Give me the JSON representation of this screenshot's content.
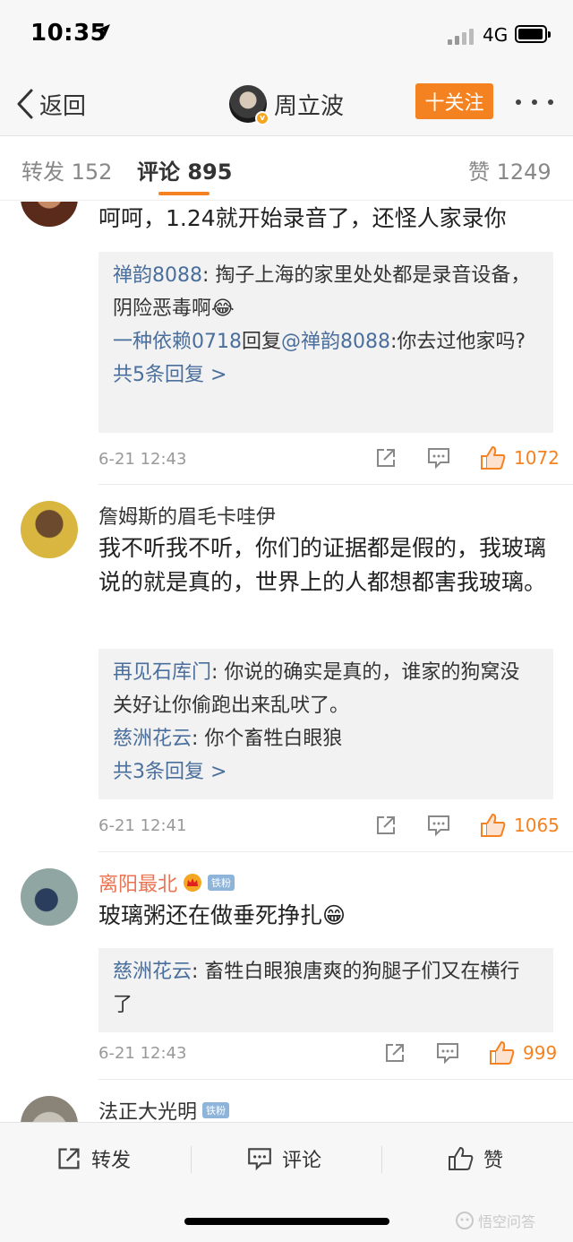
{
  "status_bar": {
    "time": "10:35",
    "network": "4G"
  },
  "nav": {
    "back_label": "返回",
    "profile_name": "周立波",
    "follow_label": "十关注"
  },
  "tabs": [
    {
      "label": "转发 152"
    },
    {
      "label": "评论 895",
      "active": true
    },
    {
      "label": "赞 1249"
    }
  ],
  "comments": [
    {
      "text": "呵呵，1.24就开始录音了，还怪人家录你",
      "replies": [
        {
          "user": "禅韵8088",
          "text": ": 掏子上海的家里处处都是录音设备，阴险恶毒啊😂"
        },
        {
          "user": "一种依赖0718",
          "mid": "回复",
          "user2": "@禅韵8088",
          "text": ":你去过他家吗?"
        }
      ],
      "more_replies": "共5条回复 >",
      "time": "6-21 12:43",
      "likes": "1072"
    },
    {
      "name": "詹姆斯的眉毛卡哇伊",
      "text": "我不听我不听，你们的证据都是假的，我玻璃说的就是真的，世界上的人都想都害我玻璃。",
      "replies": [
        {
          "user": "再见石库门",
          "text": ": 你说的确实是真的，谁家的狗窝没关好让你偷跑出来乱吠了。"
        },
        {
          "user": "慈洲花云",
          "text": ": 你个畜牲白眼狼"
        }
      ],
      "more_replies": "共3条回复 >",
      "time": "6-21 12:41",
      "likes": "1065"
    },
    {
      "name": "离阳最北",
      "badge": "铁粉",
      "text": "玻璃粥还在做垂死挣扎😁",
      "replies": [
        {
          "user": "慈洲花云",
          "text": ": 畜牲白眼狼唐爽的狗腿子们又在横行了"
        }
      ],
      "time": "6-21 12:43",
      "likes": "999"
    },
    {
      "name": "法正大光明",
      "badge": "铁粉"
    }
  ],
  "toolbar": {
    "repost_label": "转发",
    "comment_label": "评论",
    "like_label": "赞"
  },
  "watermark": "悟空问答",
  "colors": {
    "accent": "#f58220",
    "link": "#4a6f9c",
    "name_highlight": "#eb7350"
  }
}
